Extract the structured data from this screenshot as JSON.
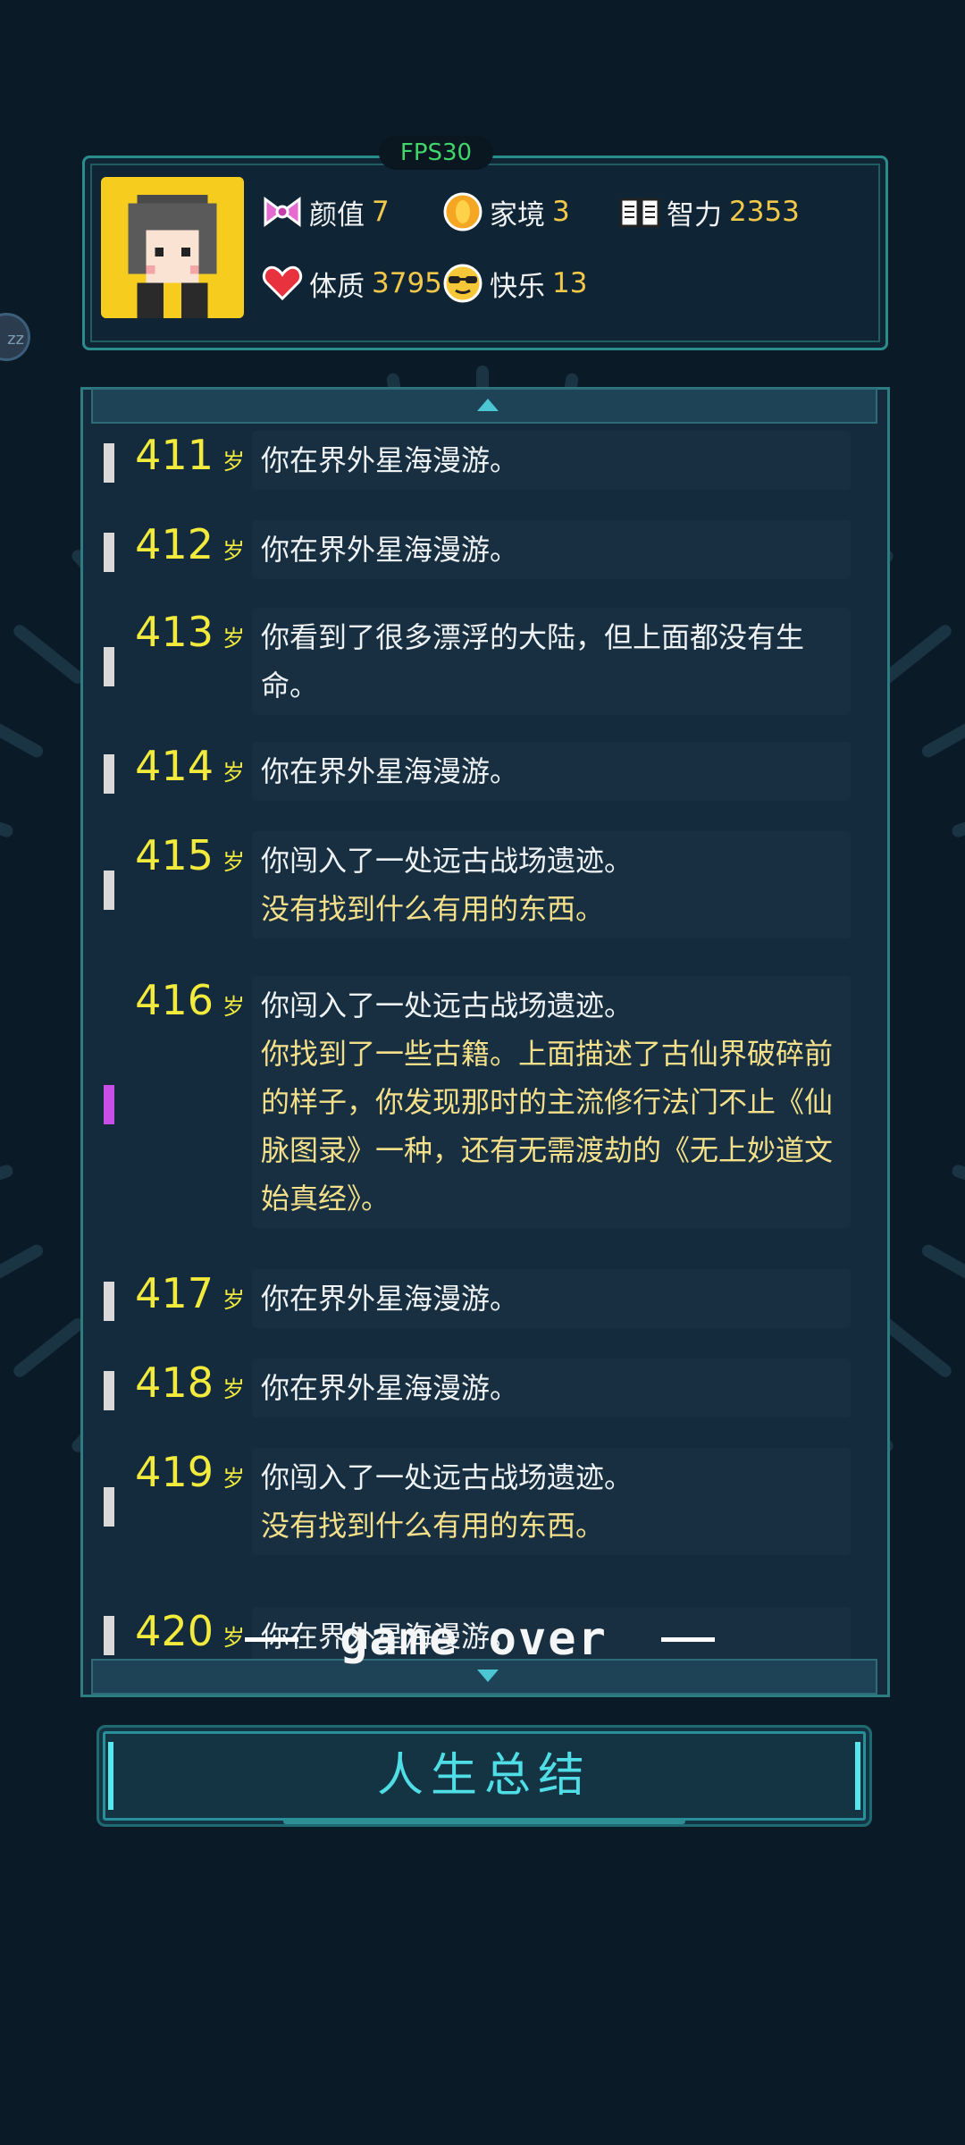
{
  "fps": "FPS30",
  "stats": [
    {
      "id": "appearance",
      "icon": "bow-icon",
      "label": "颜值",
      "value": "7"
    },
    {
      "id": "family",
      "icon": "coin-icon",
      "label": "家境",
      "value": "3"
    },
    {
      "id": "intelligence",
      "icon": "book-icon",
      "label": "智力",
      "value": "2353"
    },
    {
      "id": "physique",
      "icon": "heart-icon",
      "label": "体质",
      "value": "3795"
    },
    {
      "id": "happiness",
      "icon": "sunglasses-face-icon",
      "label": "快乐",
      "value": "13"
    }
  ],
  "age_unit": "岁",
  "entries": [
    {
      "age": "411",
      "lines": [
        {
          "t": "你在界外星海漫游。",
          "c": "w"
        }
      ],
      "marker": "#d9d9d9"
    },
    {
      "age": "412",
      "lines": [
        {
          "t": "你在界外星海漫游。",
          "c": "w"
        }
      ],
      "marker": "#d9d9d9"
    },
    {
      "age": "413",
      "lines": [
        {
          "t": "你看到了很多漂浮的大陆，但上面都没有生命。",
          "c": "w"
        }
      ],
      "marker": "#d9d9d9"
    },
    {
      "age": "414",
      "lines": [
        {
          "t": "你在界外星海漫游。",
          "c": "w"
        }
      ],
      "marker": "#d9d9d9"
    },
    {
      "age": "415",
      "lines": [
        {
          "t": "你闯入了一处远古战场遗迹。",
          "c": "w"
        },
        {
          "t": "没有找到什么有用的东西。",
          "c": "y"
        }
      ],
      "marker": "#d9d9d9"
    },
    {
      "age": "416",
      "lines": [
        {
          "t": "你闯入了一处远古战场遗迹。",
          "c": "w"
        },
        {
          "t": "你找到了一些古籍。上面描述了古仙界破碎前的样子，你发现那时的主流修行法门不止《仙脉图录》一种，还有无需渡劫的《无上妙道文始真经》。",
          "c": "y"
        }
      ],
      "marker": "#c84fe6"
    },
    {
      "age": "417",
      "lines": [
        {
          "t": "你在界外星海漫游。",
          "c": "w"
        }
      ],
      "marker": "#d9d9d9"
    },
    {
      "age": "418",
      "lines": [
        {
          "t": "你在界外星海漫游。",
          "c": "w"
        }
      ],
      "marker": "#d9d9d9"
    },
    {
      "age": "419",
      "lines": [
        {
          "t": "你闯入了一处远古战场遗迹。",
          "c": "w"
        },
        {
          "t": "没有找到什么有用的东西。",
          "c": "y"
        }
      ],
      "marker": "#d9d9d9"
    },
    {
      "age": "420",
      "lines": [
        {
          "t": "你在界外星海漫游。",
          "c": "w"
        }
      ],
      "marker": "#d9d9d9"
    }
  ],
  "game_over": "game over",
  "summary_button": "人生总结",
  "side_bubble": "zz"
}
